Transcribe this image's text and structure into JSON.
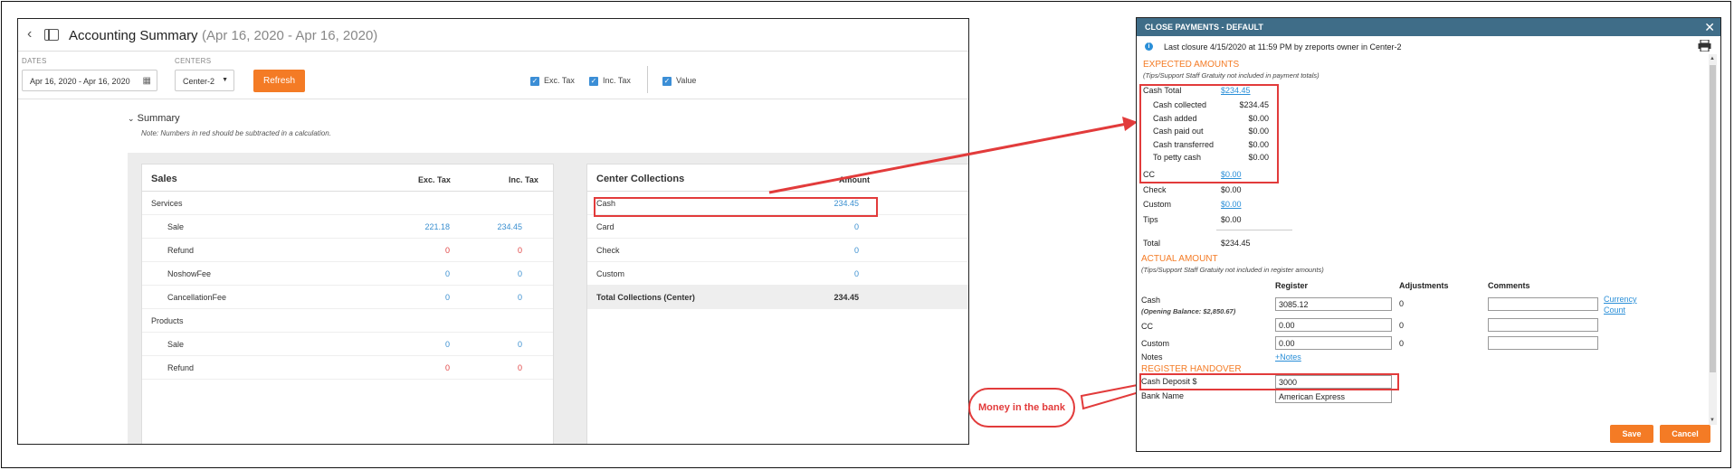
{
  "app": {
    "title": "Accounting Summary",
    "date_range": "(Apr 16, 2020 - Apr 16, 2020)",
    "filters": {
      "dates_label": "DATES",
      "dates_value": "Apr 16, 2020 - Apr 16, 2020",
      "centers_label": "CENTERS",
      "center_value": "Center-2",
      "refresh_label": "Refresh",
      "exc_tax_label": "Exc. Tax",
      "inc_tax_label": "Inc. Tax",
      "value_label": "Value"
    },
    "summary": {
      "heading": "Summary",
      "note": "Note: Numbers in red should be subtracted in a calculation."
    },
    "sales": {
      "title": "Sales",
      "col_exc": "Exc. Tax",
      "col_inc": "Inc. Tax",
      "rows": [
        {
          "label": "Services",
          "exc": "",
          "inc": ""
        },
        {
          "label": "Sale",
          "exc": "221.18",
          "inc": "234.45"
        },
        {
          "label": "Refund",
          "exc": "0",
          "inc": "0"
        },
        {
          "label": "NoshowFee",
          "exc": "0",
          "inc": "0"
        },
        {
          "label": "CancellationFee",
          "exc": "0",
          "inc": "0"
        },
        {
          "label": "Products",
          "exc": "",
          "inc": ""
        },
        {
          "label": "Sale",
          "exc": "0",
          "inc": "0"
        },
        {
          "label": "Refund",
          "exc": "0",
          "inc": "0"
        }
      ]
    },
    "collections": {
      "title": "Center Collections",
      "col_amount": "Amount",
      "rows": [
        {
          "label": "Cash",
          "amount": "234.45"
        },
        {
          "label": "Card",
          "amount": "0"
        },
        {
          "label": "Check",
          "amount": "0"
        },
        {
          "label": "Custom",
          "amount": "0"
        }
      ],
      "total_label": "Total Collections (Center)",
      "total_amount": "234.45"
    }
  },
  "dialog": {
    "title": "CLOSE PAYMENTS - DEFAULT",
    "last_closure": "Last closure 4/15/2020 at 11:59 PM by zreports owner in Center-2",
    "expected_title": "EXPECTED AMOUNTS",
    "expected_note": "(Tips/Support Staff Gratuity not included in payment totals)",
    "cash_total_label": "Cash Total",
    "cash_total_value": "$234.45",
    "cash_breakdown": [
      {
        "label": "Cash collected",
        "value": "$234.45"
      },
      {
        "label": "Cash added",
        "value": "$0.00"
      },
      {
        "label": "Cash paid out",
        "value": "$0.00"
      },
      {
        "label": "Cash transferred",
        "value": "$0.00"
      },
      {
        "label": "To petty cash",
        "value": "$0.00"
      }
    ],
    "other_payments": [
      {
        "label": "CC",
        "value": "$0.00",
        "link": true
      },
      {
        "label": "Check",
        "value": "$0.00",
        "link": false
      },
      {
        "label": "Custom",
        "value": "$0.00",
        "link": true
      },
      {
        "label": "Tips",
        "value": "$0.00",
        "link": false
      }
    ],
    "total_label": "Total",
    "total_value": "$234.45",
    "actual_title": "ACTUAL AMOUNT",
    "actual_note": "(Tips/Support Staff Gratuity not included in register amounts)",
    "col_register": "Register",
    "col_adjustments": "Adjustments",
    "col_comments": "Comments",
    "cash_label": "Cash",
    "opening_balance": "(Opening Balance: $2,850.67)",
    "cash_register": "3085.12",
    "cash_adjust": "0",
    "currency_link_1": "Currency",
    "currency_link_2": "Count",
    "cc_label": "CC",
    "cc_register": "0.00",
    "cc_adjust": "0",
    "custom_label": "Custom",
    "custom_register": "0.00",
    "custom_adjust": "0",
    "notes_label": "Notes",
    "notes_link": "+Notes",
    "handover_title": "REGISTER HANDOVER",
    "cash_deposit_label": "Cash Deposit $",
    "cash_deposit_value": "3000",
    "bank_name_label": "Bank Name",
    "bank_name_value": "American Express",
    "save_label": "Save",
    "cancel_label": "Cancel"
  },
  "annotation": {
    "callout": "Money in the bank"
  }
}
